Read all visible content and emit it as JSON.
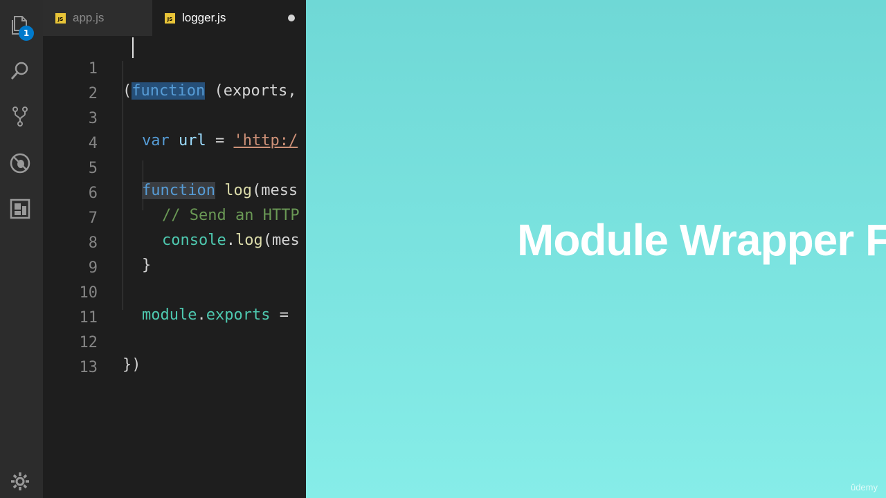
{
  "activity_bar": {
    "explorer_badge": "1",
    "icons": [
      "files-icon",
      "search-icon",
      "source-control-icon",
      "debug-icon",
      "extensions-icon",
      "gear-icon"
    ]
  },
  "tabs": [
    {
      "label": "app.js",
      "icon": "JS",
      "active": false
    },
    {
      "label": "logger.js",
      "icon": "JS",
      "active": true,
      "dirty": true
    }
  ],
  "editor": {
    "line_numbers": [
      "1",
      "2",
      "3",
      "4",
      "5",
      "6",
      "7",
      "8",
      "9",
      "10",
      "11",
      "12",
      "13"
    ],
    "code": {
      "l1_open": "(",
      "l1_kw": "function",
      "l1_rest": " (exports,",
      "l3_kw": "var",
      "l3_name": " url",
      "l3_eq": " = ",
      "l3_str": "'http:/",
      "l5_kw": "function",
      "l5_name": " log",
      "l5_rest": "(mess",
      "l6_comment": "// Send an HTTP",
      "l7_obj": "console",
      "l7_dot": ".",
      "l7_fn": "log",
      "l7_rest": "(mes",
      "l8_close": "}",
      "l10_obj": "module",
      "l10_dot": ".",
      "l10_prop": "exports",
      "l10_eq": " =",
      "l12_close": "})"
    }
  },
  "slide": {
    "title": "Module Wrapper F",
    "watermark": "ûdemy"
  },
  "colors": {
    "slide_bg_top": "#6fd8d6",
    "slide_bg_bottom": "#86ede8",
    "accent_badge": "#007acc",
    "js_badge": "#e8c438"
  }
}
